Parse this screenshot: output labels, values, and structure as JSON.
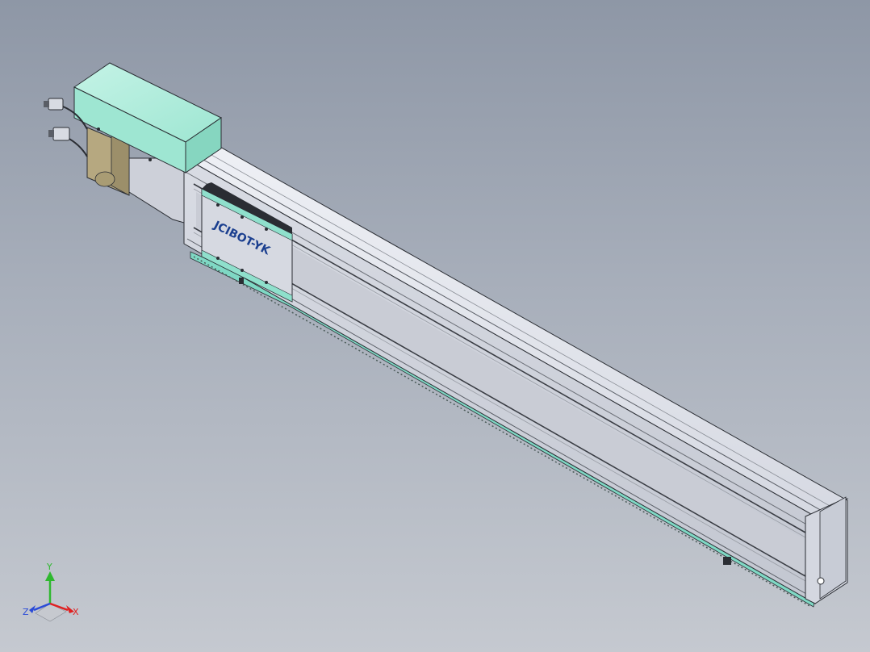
{
  "model": {
    "carriage_logo_text": "JCIBOT-YK",
    "logo_color": "#1b3f8f"
  },
  "colors": {
    "background_top": "#8e97a6",
    "background_bottom": "#c5c9d0",
    "motor_housing": "#9ee6d2",
    "profile_light": "#e4e6ee",
    "profile_mid": "#cfd2db",
    "profile_dark": "#a9adb8",
    "edge": "#2a2d33",
    "accent_teal": "#7fd8c4"
  },
  "triad": {
    "x_label": "X",
    "y_label": "Y",
    "z_label": "Z",
    "x_color": "#e02020",
    "y_color": "#2fb82f",
    "z_color": "#2a4bd8"
  }
}
